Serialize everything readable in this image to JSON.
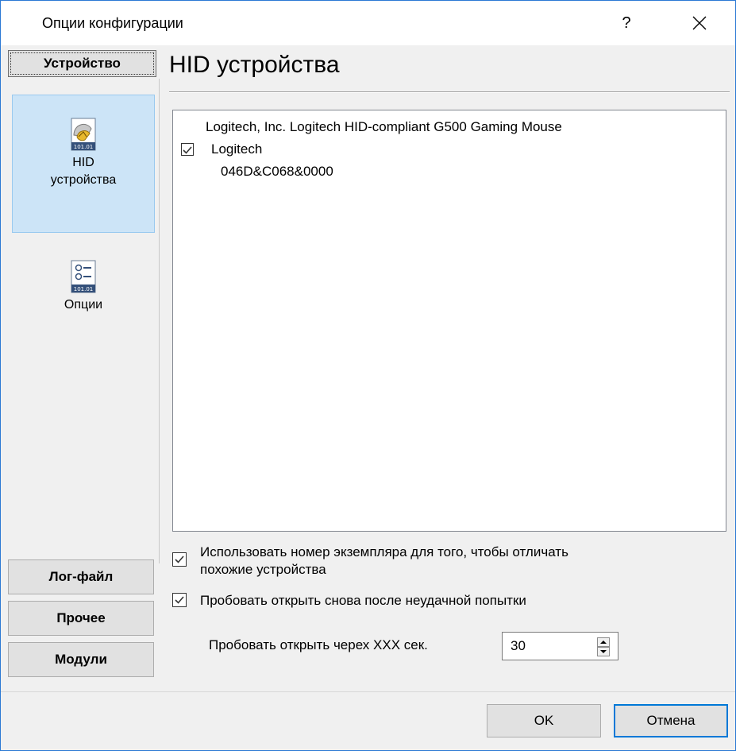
{
  "window": {
    "title": "Опции конфигурации",
    "help_label": "?",
    "close_label": "✕"
  },
  "sidebar": {
    "header": "Устройство",
    "items": [
      {
        "label_line1": "HID",
        "label_line2": "устройства",
        "icon": "hid-device-icon",
        "selected": true
      },
      {
        "label_line1": "Опции",
        "icon": "options-icon",
        "selected": false
      }
    ],
    "buttons": [
      "Лог-файл",
      "Прочее",
      "Модули"
    ]
  },
  "panel": {
    "title": "HID устройства",
    "device": {
      "name": "Logitech, Inc. Logitech HID-compliant G500 Gaming Mouse",
      "vendor": "Logitech",
      "id": "046D&C068&0000",
      "checked": true
    },
    "options": {
      "use_instance_line1": "Использовать номер экземпляра для того, чтобы отличать",
      "use_instance_line2": "похожие устройства",
      "retry_open": "Пробовать открыть снова после неудачной попытки",
      "retry_label": "Пробовать открыть черех XXX сек.",
      "retry_value": "30"
    }
  },
  "footer": {
    "ok": "OK",
    "cancel": "Отмена"
  },
  "colors": {
    "accent": "#0078d7",
    "selected_bg": "#cce4f7",
    "window_border": "#2b79d4"
  }
}
